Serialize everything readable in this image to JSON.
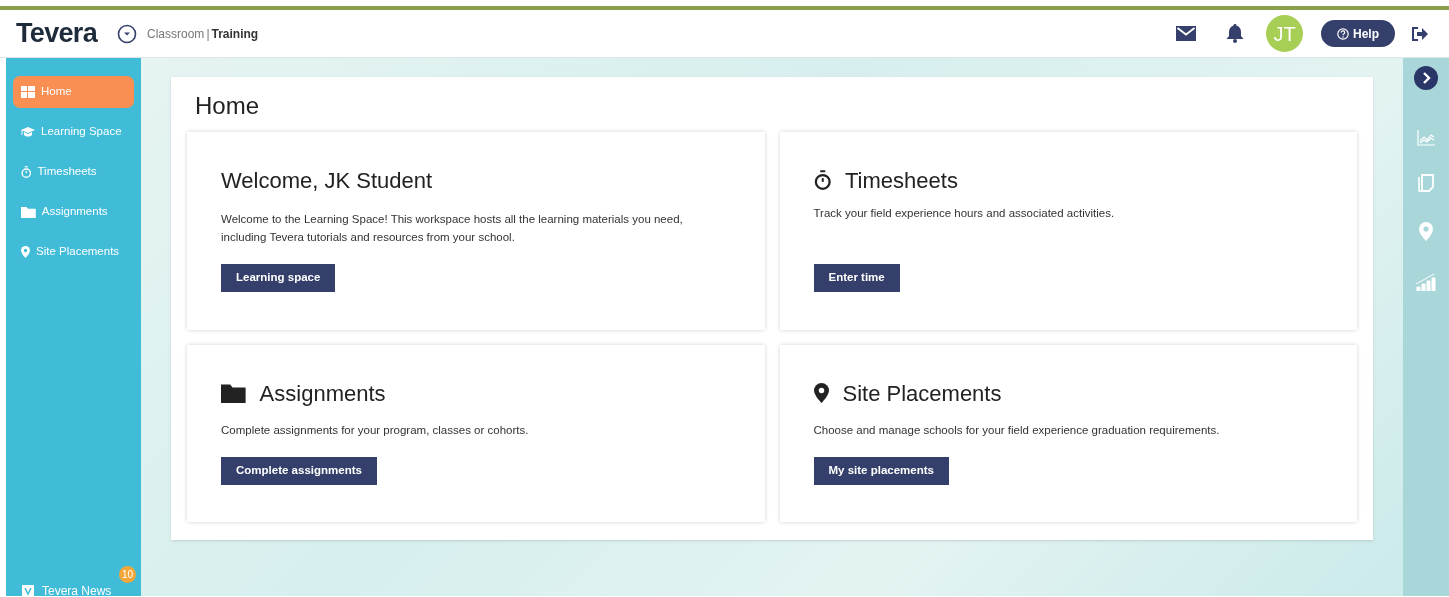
{
  "header": {
    "logo": "Tevera",
    "breadcrumb": {
      "context": "Classroom",
      "separator": "|",
      "workspace": "Training"
    },
    "avatar": "JT",
    "help": "Help"
  },
  "sidebar": {
    "items": [
      {
        "label": "Home",
        "kind": "grid",
        "selected": true
      },
      {
        "label": "Learning Space",
        "kind": "cap",
        "selected": false
      },
      {
        "label": "Timesheets",
        "kind": "stopwatch",
        "selected": false
      },
      {
        "label": "Assignments",
        "kind": "folder",
        "selected": false
      },
      {
        "label": "Site Placements",
        "kind": "pin",
        "selected": false
      }
    ],
    "news": {
      "label": "Tevera News",
      "badge": "10"
    }
  },
  "page_title": "Home",
  "cards": [
    {
      "kind": "plain",
      "title": "Welcome, JK Student",
      "text": "Welcome to the Learning Space! This workspace hosts all the learning materials you need, including Tevera tutorials and resources from your school.",
      "button": "Learning space"
    },
    {
      "kind": "stopwatch",
      "title": "Timesheets",
      "text": "Track your field experience hours and associated activities.",
      "button": "Enter time"
    },
    {
      "kind": "folder",
      "title": "Assignments",
      "text": "Complete assignments for your program, classes or cohorts.",
      "button": "Complete assignments"
    },
    {
      "kind": "pin",
      "title": "Site Placements",
      "text": "Choose and manage schools for your field experience graduation requirements.",
      "button": "My site placements"
    }
  ]
}
